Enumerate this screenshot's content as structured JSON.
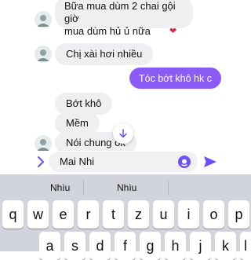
{
  "messages": {
    "m1_line1": "Bữa mua dùm 2 chai gội giờ",
    "m1_line2": "mua dùm hủ ủ nữa",
    "m1_reaction": "❤",
    "m2": "Chị xài hơi nhiều",
    "out1": "Tóc bớt khô hk c",
    "m3": "Bớt khô",
    "m4": "Mềm",
    "m5": "Nói chung ok"
  },
  "composer": {
    "expand_icon": "chevron-right-icon",
    "input_value": "Mai Nhi",
    "emoji_icon": "emoji-icon",
    "send_icon": "send-icon",
    "accent": "#6c4ff6"
  },
  "keyboard": {
    "suggestions": [
      "Nhìu",
      "Nhìu"
    ],
    "row1": [
      "q",
      "w",
      "e",
      "r",
      "t",
      "z",
      "u",
      "i",
      "o",
      "p"
    ],
    "row2": [
      "a",
      "s",
      "d",
      "f",
      "g",
      "h",
      "j",
      "k",
      "l"
    ]
  }
}
